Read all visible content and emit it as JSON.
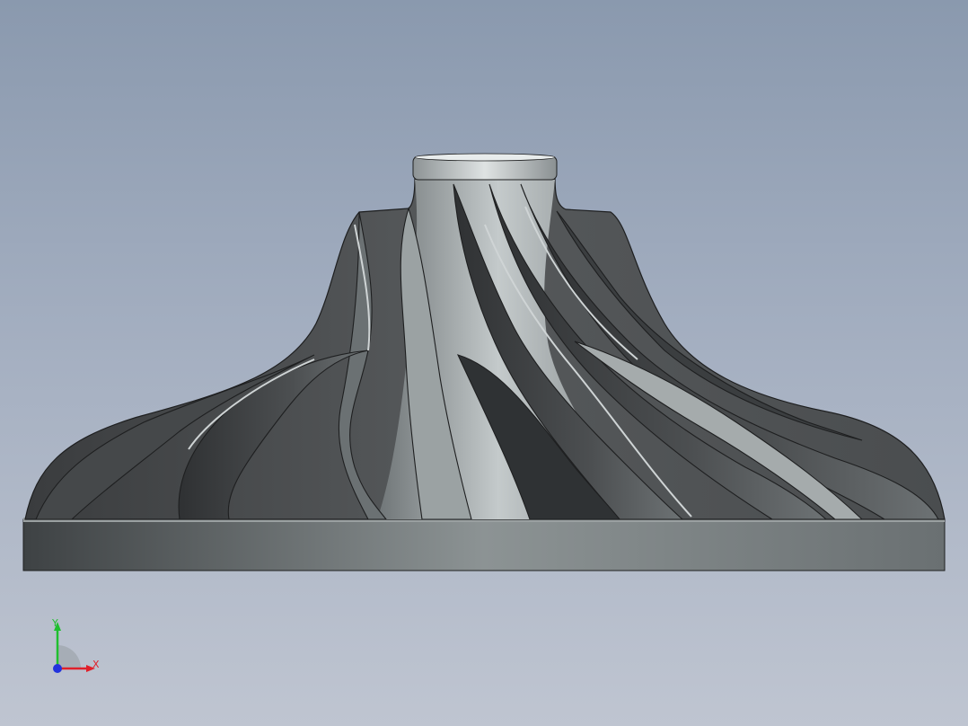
{
  "viewport": {
    "background_top": "#8a99ae",
    "background_bottom": "#bfc5d1"
  },
  "model": {
    "name": "impeller",
    "shade_dark": "#3c3e40",
    "shade_mid": "#5e6366",
    "shade_light": "#b6bcbd",
    "edge_color": "#1e1f20"
  },
  "triad": {
    "x_label": "X",
    "y_label": "Y",
    "x_color": "#e0202a",
    "y_color": "#1fbf2f",
    "z_color": "#2233dd"
  }
}
